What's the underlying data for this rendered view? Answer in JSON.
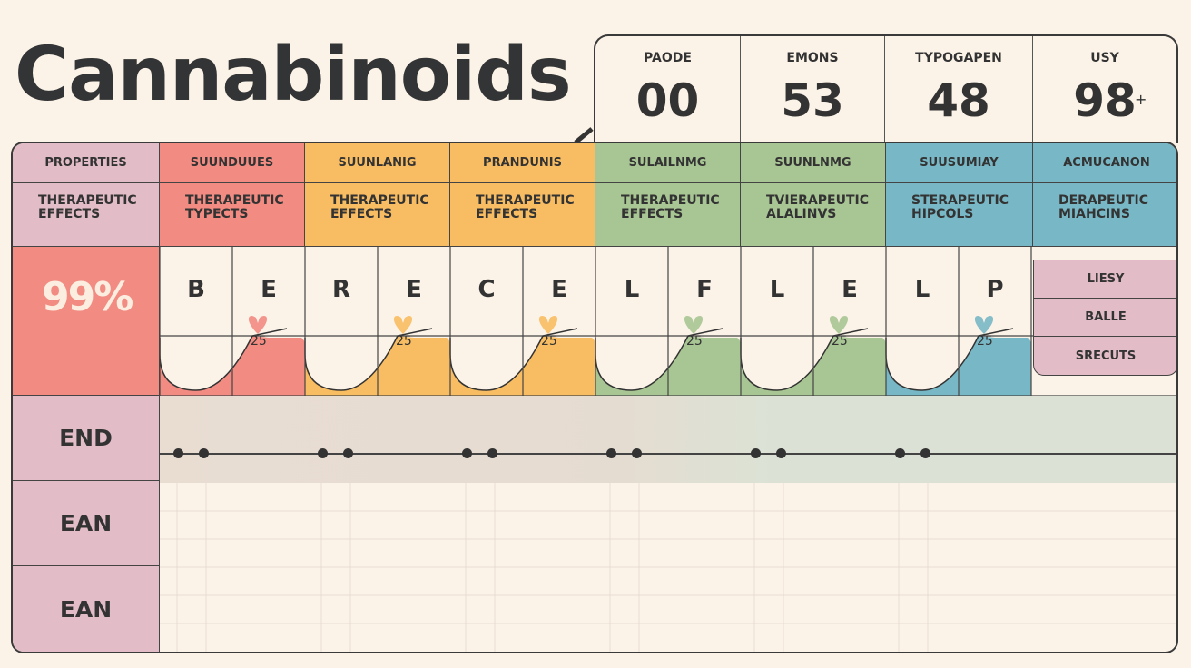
{
  "title": "Cannabinoids",
  "stats": [
    {
      "label": "PAODE",
      "value": "00"
    },
    {
      "label": "EMONS",
      "value": "53"
    },
    {
      "label": "TYPOGAPEN",
      "value": "48"
    },
    {
      "label": "USY",
      "value": "98",
      "suffix": "+"
    }
  ],
  "table": {
    "header_row1": [
      "PROPERTIES",
      "SUUNDUUES",
      "SUUNLANIG",
      "PRANDUNIS",
      "SULAILNMG",
      "SUUNLNMG",
      "SUUSUMIAY",
      "ACMUCANON"
    ],
    "header_row2": [
      "THERAPEUTIC\nEFFECTS",
      "THERAPEUTIC\nTYPECTS",
      "THERAPEUTIC\nEFFECTS",
      "THERAPEUTIC\nEFFECTS",
      "THERAPEUTIC\nEFFECTS",
      "TVIERAPEUTIC\nALALINVS",
      "STERAPEUTIC\nHIPCOLS",
      "DERAPEUTIC\nMIAHCINS"
    ],
    "percent_label": "99%",
    "letters": [
      "B",
      "E",
      "R",
      "E",
      "C",
      "E",
      "L",
      "F",
      "L",
      "E",
      "L",
      "P"
    ],
    "bubble_values": [
      "25",
      "25",
      "25",
      "25",
      "25",
      "25"
    ],
    "side_labels": [
      "END",
      "EAN",
      "EAN"
    ],
    "side_menu": [
      "LIESY",
      "BALLE",
      "SRECUTS"
    ]
  },
  "colors": {
    "pink": "#e2bcc7",
    "red": "#f28b82",
    "orange": "#f8bd62",
    "green": "#a8c594",
    "blue": "#78b7c5",
    "background": "#fcf3e8"
  }
}
